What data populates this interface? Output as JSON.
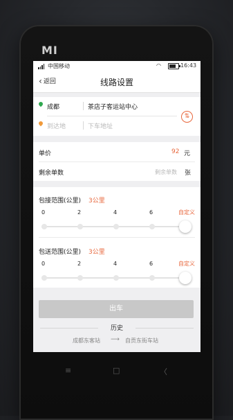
{
  "device": {
    "brand_logo": "MI"
  },
  "status_bar": {
    "carrier": "中国移动",
    "time": "16:43",
    "icons": [
      "signal-icon",
      "wifi-icon",
      "battery-icon"
    ]
  },
  "nav": {
    "back_label": "返回",
    "title": "线路设置"
  },
  "route": {
    "from_city": "成都",
    "from_station": "茶店子客运站中心",
    "to_city_placeholder": "到达地",
    "to_station_placeholder": "下车地址"
  },
  "pricing": {
    "price_label": "单价",
    "price_value": "92",
    "price_unit": "元",
    "tickets_label": "剩余单数",
    "tickets_placeholder": "剩余单数",
    "tickets_unit": "张"
  },
  "pickup_range": {
    "label": "包接范围(公里)",
    "value": "3公里",
    "ticks": [
      "0",
      "2",
      "4",
      "6"
    ],
    "custom_label": "自定义",
    "selected_fraction": 1.0
  },
  "dropoff_range": {
    "label": "包送范围(公里)",
    "value": "3公里",
    "ticks": [
      "0",
      "2",
      "4",
      "6"
    ],
    "custom_label": "自定义",
    "selected_fraction": 1.0
  },
  "actions": {
    "depart_label": "出车"
  },
  "history": {
    "title": "历史",
    "items": [
      {
        "from": "成都东客站",
        "arrow": "⟶",
        "to": "自贡东街车站"
      }
    ]
  },
  "softkeys": {
    "menu": "≡",
    "home": "□",
    "back": "〈"
  },
  "colors": {
    "accent": "#e8673c",
    "green": "#2fa84f",
    "disabled": "#c8c8c8"
  }
}
